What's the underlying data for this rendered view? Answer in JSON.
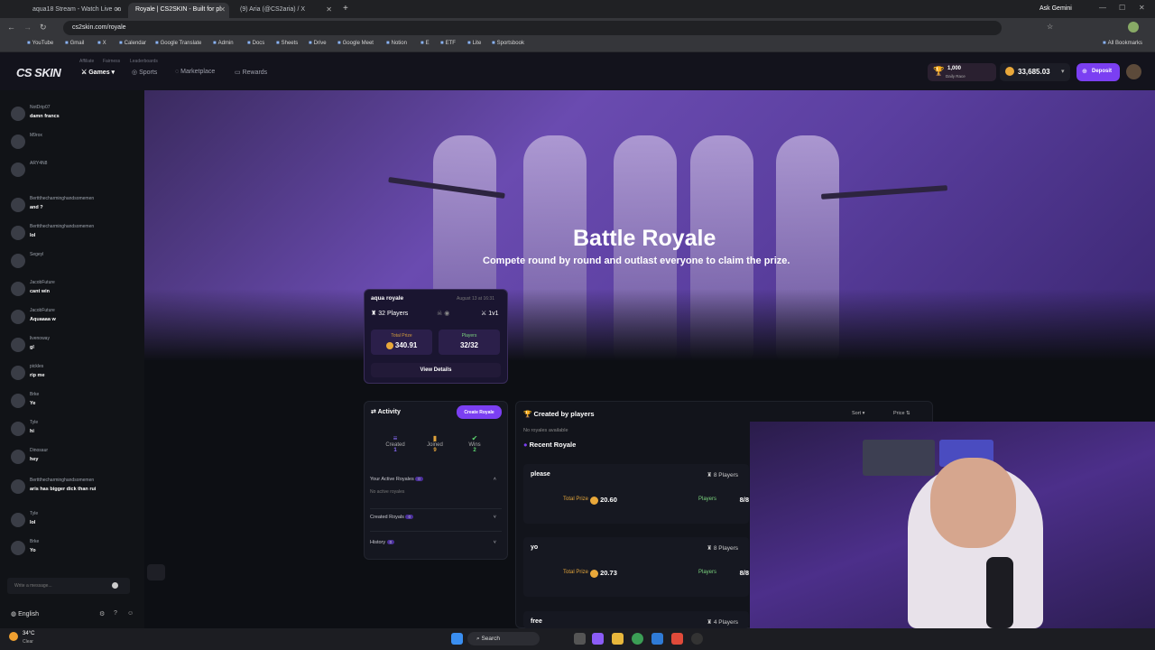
{
  "browser": {
    "tabs": [
      {
        "title": "aqua18 Stream - Watch Live on"
      },
      {
        "title": "Royale | CS2SKIN - Built for pl"
      },
      {
        "title": "(9) Aria (@CS2aria) / X"
      }
    ],
    "url": "cs2skin.com/royale",
    "ask_gemini": "Ask Gemini",
    "bookmarks": [
      "YouTube",
      "Gmail",
      "X",
      "Calendar",
      "Google Translate",
      "Admin",
      "Docs",
      "Sheets",
      "Drive",
      "Google Meet",
      "Notion",
      "E",
      "ETF",
      "Lite",
      "Sportsbook"
    ],
    "all_bookmarks": "All Bookmarks"
  },
  "site": {
    "logo": "CS SKIN",
    "subnav": [
      "Affiliate",
      "Fairness",
      "Leaderboards"
    ],
    "nav": [
      {
        "label": "Games"
      },
      {
        "label": "Sports"
      },
      {
        "label": "Marketplace"
      },
      {
        "label": "Rewards"
      }
    ],
    "race_amount": "1,000",
    "race_label": "Daily Race",
    "balance": "33,685.03",
    "deposit_label": "Deposit"
  },
  "chat": {
    "messages": [
      {
        "user": "NotDrip07",
        "text": "damn francs"
      },
      {
        "user": "M9rox",
        "text": ""
      },
      {
        "user": "ARY4N8",
        "text": ""
      },
      {
        "user": "Berttthecharminghandsomemen",
        "text": "and ?"
      },
      {
        "user": "Berttthecharminghandsomemen",
        "text": "lol"
      },
      {
        "user": "Segeyl",
        "text": ""
      },
      {
        "user": "JacobFuture",
        "text": "cant win"
      },
      {
        "user": "JacobFuture",
        "text": "Aquaaaa w"
      },
      {
        "user": "livenoway",
        "text": "gl"
      },
      {
        "user": "pickles",
        "text": "rip me"
      },
      {
        "user": "Brke",
        "text": "Ye"
      },
      {
        "user": "Tyle",
        "text": "hi"
      },
      {
        "user": "Dinosaur",
        "text": "hey"
      },
      {
        "user": "Berttthecharminghandsomemen",
        "text": "aris has bigger dick than rui"
      },
      {
        "user": "Tyle",
        "text": "lol"
      },
      {
        "user": "Brke",
        "text": "Yo"
      }
    ],
    "input_placeholder": "Write a message...",
    "language": "English"
  },
  "hero": {
    "title": "Battle Royale",
    "subtitle": "Compete round by round and outlast everyone to claim the prize."
  },
  "featured": {
    "name": "aqua royale",
    "date": "August 13 at 16:31",
    "players": "32 Players",
    "mode": "1v1",
    "total_prize_label": "Total Prize",
    "total_prize": "340.91",
    "players_label": "Players",
    "players_count": "32/32",
    "view_label": "View Details"
  },
  "activity": {
    "title": "Activity",
    "create_label": "Create Royale",
    "stats": [
      {
        "label": "Created",
        "value": "1"
      },
      {
        "label": "Joined",
        "value": "9"
      },
      {
        "label": "Wins",
        "value": "2"
      }
    ],
    "active_label": "Your Active Royales",
    "active_count": "0",
    "no_active": "No active royales",
    "created_label": "Created Royals",
    "created_count": "0",
    "history_label": "History",
    "history_count": "0"
  },
  "created": {
    "title": "Created by players",
    "sort_label": "Sort",
    "price_label": "Price",
    "no_royales": "No royales available",
    "recent_title": "Recent Royale",
    "royales": [
      {
        "name": "please",
        "players": "8 Players",
        "prize": "20.60",
        "count": "8/8"
      },
      {
        "name": "yo",
        "players": "8 Players",
        "prize": "20.73",
        "count": "8/8"
      },
      {
        "name": "free",
        "players": "4 Players",
        "prize": "",
        "count": ""
      }
    ],
    "total_prize_label": "Total Prize",
    "players_label": "Players"
  },
  "taskbar": {
    "temp": "34°C",
    "weather": "Clear",
    "search": "Search"
  }
}
